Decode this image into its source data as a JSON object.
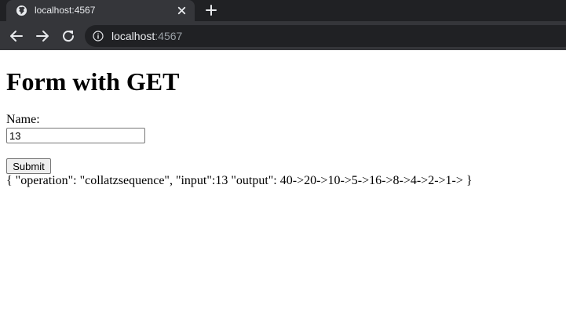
{
  "browser": {
    "tab": {
      "title": "localhost:4567"
    },
    "address": {
      "host": "localhost",
      "port": ":4567"
    }
  },
  "page": {
    "heading": "Form with GET",
    "name_label": "Name:",
    "name_value": "13",
    "submit_label": "Submit",
    "result_text": "{ \"operation\": \"collatzsequence\", \"input\":13 \"output\": 40->20->10->5->16->8->4->2->1-> }"
  },
  "icons": {
    "tab": "globe-icon",
    "tab_close": "close-icon",
    "new_tab": "plus-icon",
    "back": "arrow-left-icon",
    "forward": "arrow-right-icon",
    "reload": "reload-icon",
    "site_info": "info-icon"
  }
}
